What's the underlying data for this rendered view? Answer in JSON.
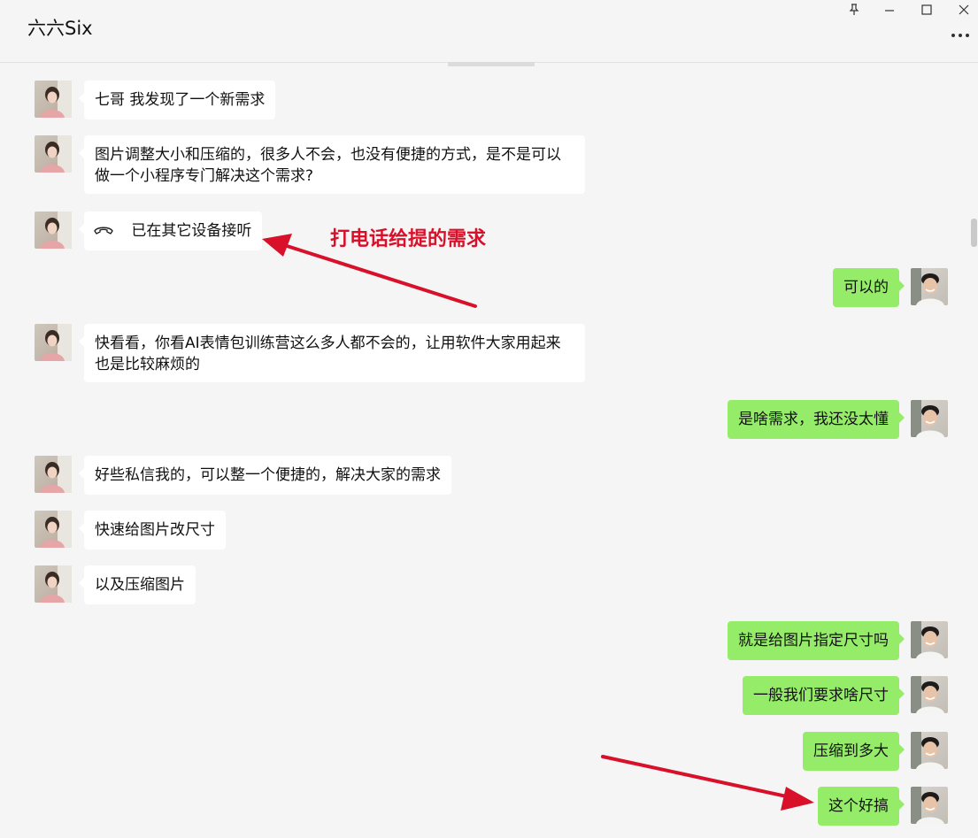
{
  "window": {
    "title": "六六Six"
  },
  "annotations": {
    "call_note": "打电话给提的需求"
  },
  "messages": {
    "m1": "七哥 我发现了一个新需求",
    "m2_line1": "图片调整大小和压缩的，很多人不会，也没有便捷的方式，是不是可以",
    "m2_line2": "做一个小程序专门解决这个需求?",
    "m3": "已在其它设备接听",
    "m4": "可以的",
    "m5_line1": "快看看，你看AI表情包训练营这么多人都不会的，让用软件大家用起来",
    "m5_line2": "也是比较麻烦的",
    "m6": "是啥需求，我还没太懂",
    "m7": "好些私信我的，可以整一个便捷的，解决大家的需求",
    "m8": "快速给图片改尺寸",
    "m9": "以及压缩图片",
    "m10": "就是给图片指定尺寸吗",
    "m11": "一般我们要求啥尺寸",
    "m12": "压缩到多大",
    "m13": "这个好搞"
  },
  "colors": {
    "incoming_bubble": "#ffffff",
    "outgoing_bubble": "#95ec69",
    "annotation_red": "#d8102a",
    "background": "#f5f5f5"
  },
  "icons": {
    "pin": "pin-icon",
    "minimize": "minimize-icon",
    "maximize": "maximize-icon",
    "close": "close-icon",
    "more": "more-icon",
    "call": "phone-hangup-icon"
  }
}
